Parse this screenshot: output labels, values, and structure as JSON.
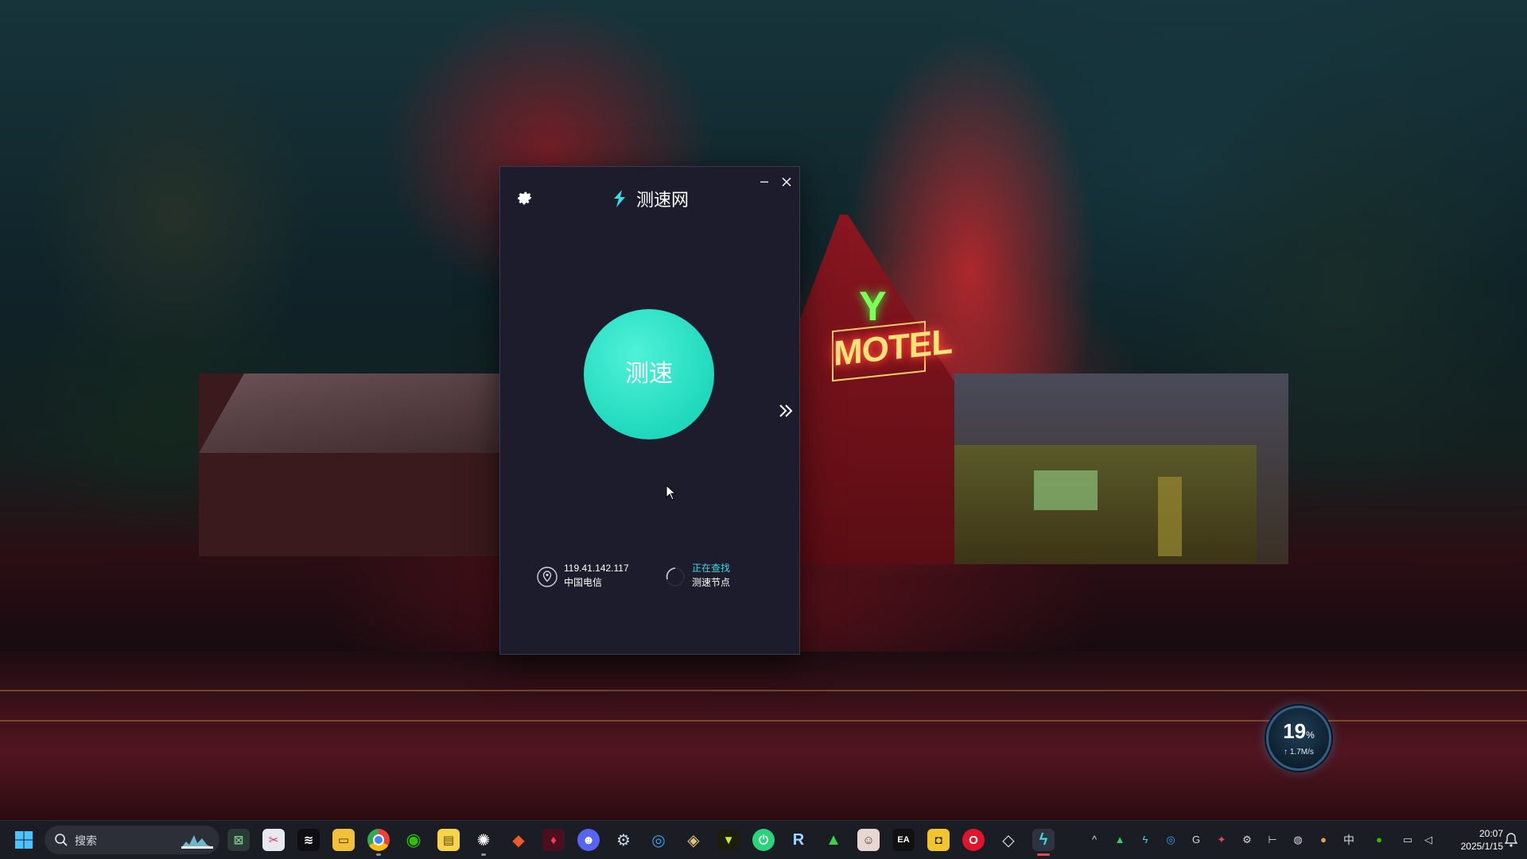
{
  "app": {
    "title": "测速网",
    "start_label": "测速",
    "ip": "119.41.142.117",
    "isp": "中国电信",
    "node_status": "正在查找",
    "node_label": "测速节点",
    "accent_color": "#20d9bd"
  },
  "wallpaper": {
    "sign_text": "MOTEL",
    "sign_letter": "Y"
  },
  "net_widget": {
    "percent": "19",
    "percent_unit": "%",
    "rate": "↑ 1.7M/s"
  },
  "taskbar": {
    "search_placeholder": "搜索",
    "apps": [
      {
        "name": "xbox-icon",
        "glyph": "⊠"
      },
      {
        "name": "snipping-tool-icon",
        "glyph": "✂"
      },
      {
        "name": "capcut-icon",
        "glyph": "≋"
      },
      {
        "name": "file-explorer-icon",
        "glyph": ""
      },
      {
        "name": "chrome-icon",
        "glyph": ""
      },
      {
        "name": "wechat-icon",
        "glyph": "◉"
      },
      {
        "name": "notes-icon",
        "glyph": "▤"
      },
      {
        "name": "openai-icon",
        "glyph": "✺"
      },
      {
        "name": "game-icon",
        "glyph": "◆"
      },
      {
        "name": "red-app-icon",
        "glyph": "♦"
      },
      {
        "name": "discord-icon",
        "glyph": "☻"
      },
      {
        "name": "steam-icon",
        "glyph": "⚙"
      },
      {
        "name": "vpn-icon",
        "glyph": "◎"
      },
      {
        "name": "browser-icon",
        "glyph": "◈"
      },
      {
        "name": "vtuber-icon",
        "glyph": "▼"
      },
      {
        "name": "power-app-icon",
        "glyph": "⏻"
      },
      {
        "name": "r-app-icon",
        "glyph": "R"
      },
      {
        "name": "triangle-app-icon",
        "glyph": "▲"
      },
      {
        "name": "avatar-app-icon",
        "glyph": "☺"
      },
      {
        "name": "ea-icon",
        "glyph": "EA"
      },
      {
        "name": "launcher-icon",
        "glyph": "◘"
      },
      {
        "name": "opera-icon",
        "glyph": "O"
      },
      {
        "name": "roblox-icon",
        "glyph": "◇"
      },
      {
        "name": "speedtest-app-icon",
        "glyph": "ϟ"
      }
    ],
    "tray": [
      {
        "name": "chevron-up-icon",
        "glyph": "^"
      },
      {
        "name": "tray-triangle-icon",
        "glyph": "▲"
      },
      {
        "name": "tray-speedtest-icon",
        "glyph": "ϟ"
      },
      {
        "name": "tray-vpn-icon",
        "glyph": "◎"
      },
      {
        "name": "tray-g-icon",
        "glyph": "G"
      },
      {
        "name": "tray-steam-icon",
        "glyph": "✦"
      },
      {
        "name": "tray-steam2-icon",
        "glyph": "⚙"
      },
      {
        "name": "tray-hm-icon",
        "glyph": "⊢"
      },
      {
        "name": "tray-globe-icon",
        "glyph": "◍"
      },
      {
        "name": "microphone-icon",
        "glyph": "🎙"
      },
      {
        "name": "ime-icon",
        "glyph": "中"
      },
      {
        "name": "tray-green-icon",
        "glyph": "●"
      },
      {
        "name": "network-icon",
        "glyph": "▭"
      },
      {
        "name": "volume-icon",
        "glyph": "🔊"
      }
    ],
    "time": "20:07",
    "date": "2025/1/15"
  }
}
